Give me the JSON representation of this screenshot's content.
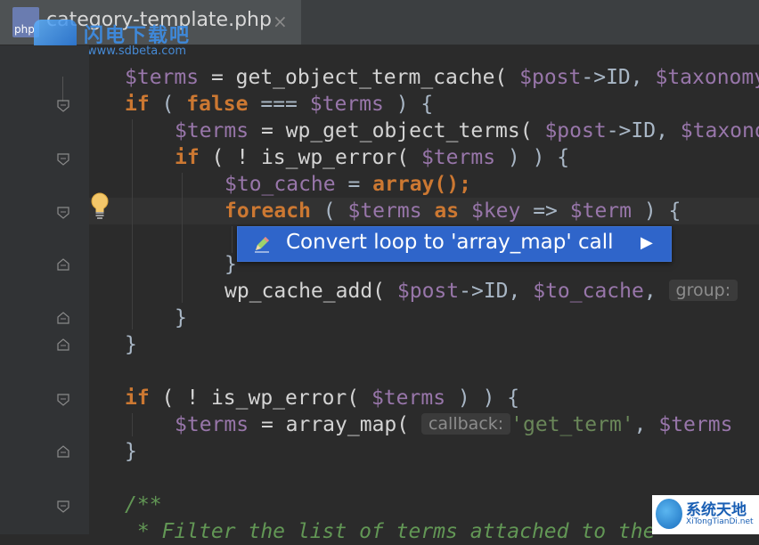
{
  "tab": {
    "file_icon_label": "php",
    "title": "category-template.php",
    "close_symbol": "×"
  },
  "icons": {
    "file": "php-file-icon",
    "close": "close-icon",
    "bulb": "lightbulb-icon",
    "intention": "pencil-icon",
    "submenu": "triangle-right-icon",
    "fold": "fold-marker-icon"
  },
  "watermark_top": {
    "text": "闪电下载吧",
    "url": "www.sdbeta.com"
  },
  "watermark_bottom": {
    "title": "系统天地",
    "url": "XiTongTianDi.net"
  },
  "code": {
    "l1": {
      "a": "$terms",
      "b": " = get_object_term_cache( ",
      "c": "$post",
      "d": "->ID, ",
      "e": "$taxonomy"
    },
    "l2": {
      "a": "if",
      "b": " ( ",
      "c": "false",
      "d": " === ",
      "e": "$terms",
      "f": " ) {"
    },
    "l3": {
      "a": "$terms",
      "b": " = wp_get_object_terms( ",
      "c": "$post",
      "d": "->ID, ",
      "e": "$taxonomy"
    },
    "l4": {
      "a": "if",
      "b": " ( ! is_wp_error( ",
      "c": "$terms",
      "d": " ) ) {"
    },
    "l5": {
      "a": "$to_cache",
      "b": " = ",
      "c": "array",
      "d": "();"
    },
    "l6": {
      "a": "foreach",
      "b": " ( ",
      "c": "$terms",
      "d": " as ",
      "e": "$key",
      "f": " => ",
      "g": "$term",
      "h": " ) {"
    },
    "l8": {
      "a": "}"
    },
    "l9": {
      "a": "wp_cache_add( ",
      "b": "$post",
      "c": "->ID, ",
      "d": "$to_cache",
      "e": ", ",
      "hint": "group:"
    },
    "l10": {
      "a": "}"
    },
    "l11": {
      "a": "}"
    },
    "l13": {
      "a": "if",
      "b": " ( ! is_wp_error( ",
      "c": "$terms",
      "d": " ) ) {"
    },
    "l14": {
      "a": "$terms",
      "b": " = array_map( ",
      "hint": "callback:",
      "c": "'get_term'",
      "d": ", ",
      "e": "$terms"
    },
    "l15": {
      "a": "}"
    },
    "l17": {
      "a": "/**"
    },
    "l18": {
      "a": " * Filter the list of terms attached to the"
    }
  },
  "intention_popup": {
    "label": "Convert loop to 'array_map' call",
    "arrow": "▶"
  },
  "colors": {
    "background": "#2b2b2b",
    "keyword": "#cc7832",
    "variable": "#9876aa",
    "string": "#6a8759",
    "comment": "#629755",
    "popup": "#2f65ca"
  }
}
